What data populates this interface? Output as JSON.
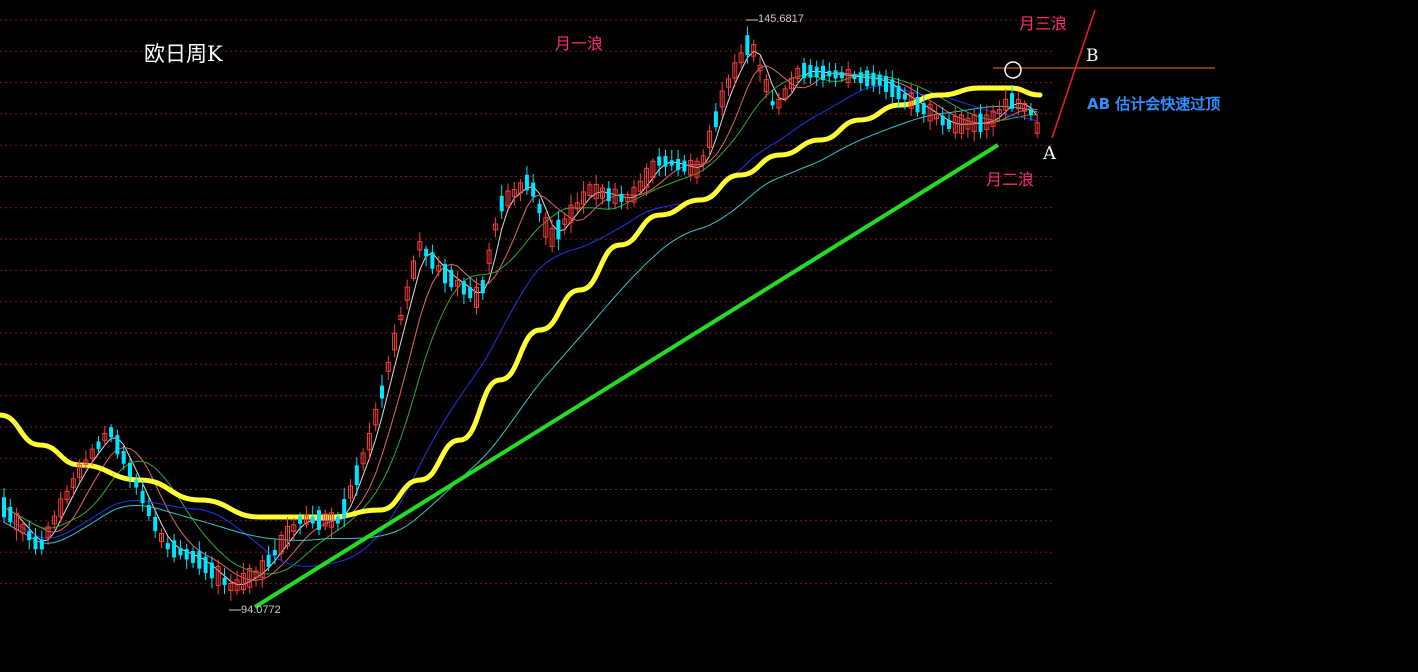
{
  "chart_data": {
    "type": "candlestick",
    "title": "欧日周K",
    "annotations": {
      "wave1": "月一浪",
      "wave2": "月二浪",
      "wave3": "月三浪",
      "point_a": "A",
      "point_b": "B",
      "note": "AB 估计会快速过顶"
    },
    "price_high_label": "145.6817",
    "price_low_label": "94.0772",
    "price_high": 145.6817,
    "price_low": 94.0772,
    "colors": {
      "up": "#ff3b3b",
      "down": "#00e5ff",
      "ma_thick": "#ffff33",
      "trendline": "#22dd22",
      "ma_blue": "#2233ee",
      "ma_cyan": "#33c6c6",
      "ma_green": "#33aa33",
      "ma_white": "#dddddd",
      "grid": "#7a1a1a",
      "annotation_wave": "#ff2a7d",
      "annotation_note": "#2f8fff",
      "level_line": "#ff7a1a",
      "wave3_line": "#ee2222"
    }
  }
}
